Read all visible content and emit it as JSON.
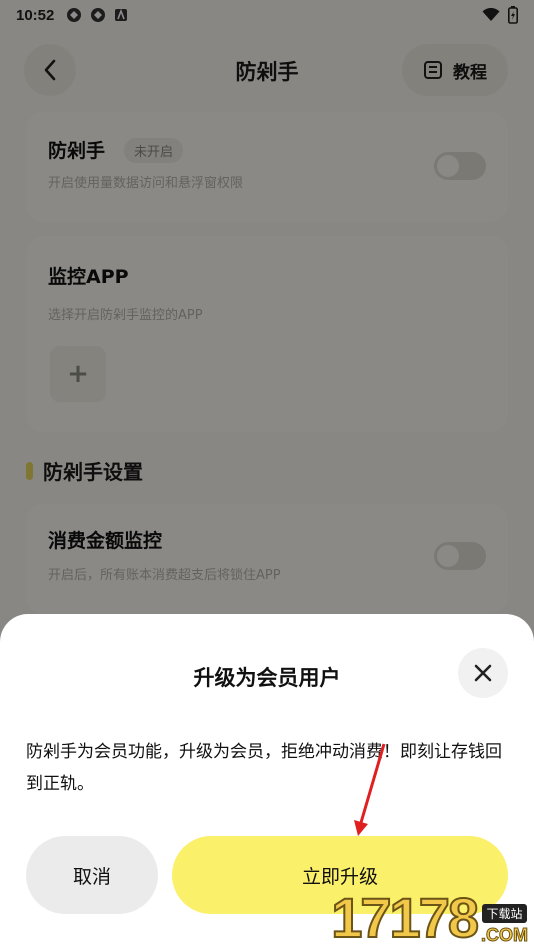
{
  "status_bar": {
    "time": "10:52"
  },
  "header": {
    "title": "防剁手",
    "tutorial_label": "教程"
  },
  "anti_spend_card": {
    "title": "防剁手",
    "badge": "未开启",
    "subtitle": "开启使用量数据访问和悬浮窗权限",
    "toggle_on": false
  },
  "monitor_app_card": {
    "title": "监控APP",
    "subtitle": "选择开启防剁手监控的APP",
    "add_label": "+"
  },
  "settings_section": {
    "title": "防剁手设置"
  },
  "spend_monitor_card": {
    "title": "消费金额监控",
    "subtitle": "开启后，所有账本消费超支后将锁住APP",
    "toggle_on": false
  },
  "dialog": {
    "title": "升级为会员用户",
    "message": "防剁手为会员功能，升级为会员，拒绝冲动消费！即刻让存钱回到正轨。",
    "cancel_label": "取消",
    "upgrade_label": "立即升级"
  },
  "watermark": {
    "digits": "17178",
    "tag": "下载站",
    "domain": ".COM"
  },
  "colors": {
    "accent": "#fbf06a",
    "background": "#f7f6ee",
    "arrow": "#e02020"
  }
}
